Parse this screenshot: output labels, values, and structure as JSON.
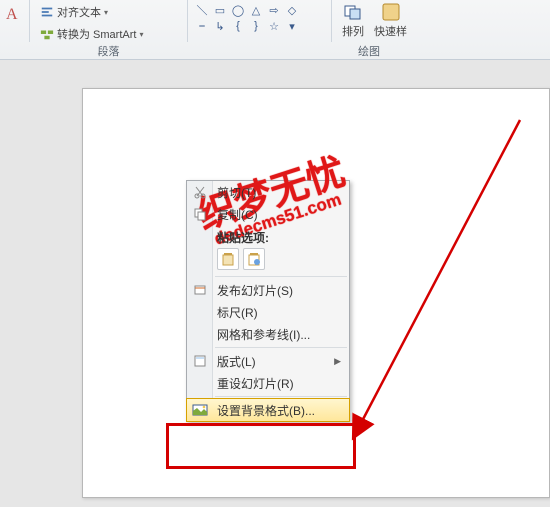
{
  "ribbon": {
    "align_text": "对齐文本",
    "convert_smartart": "转换为 SmartArt",
    "group_paragraph": "段落",
    "group_drawing": "绘图",
    "arrange": "排列",
    "quick": "快速样"
  },
  "context_menu": {
    "cut": "剪切(T)",
    "copy": "复制(C)",
    "paste_header": "粘贴选项:",
    "publish_slides": "发布幻灯片(S)",
    "ruler": "标尺(R)",
    "grid_guides": "网格和参考线(I)...",
    "layout": "版式(L)",
    "reset_slide": "重设幻灯片(R)",
    "format_background": "设置背景格式(B)..."
  },
  "watermark": {
    "main": "织梦无忧",
    "sub": "dedecms51.com"
  }
}
